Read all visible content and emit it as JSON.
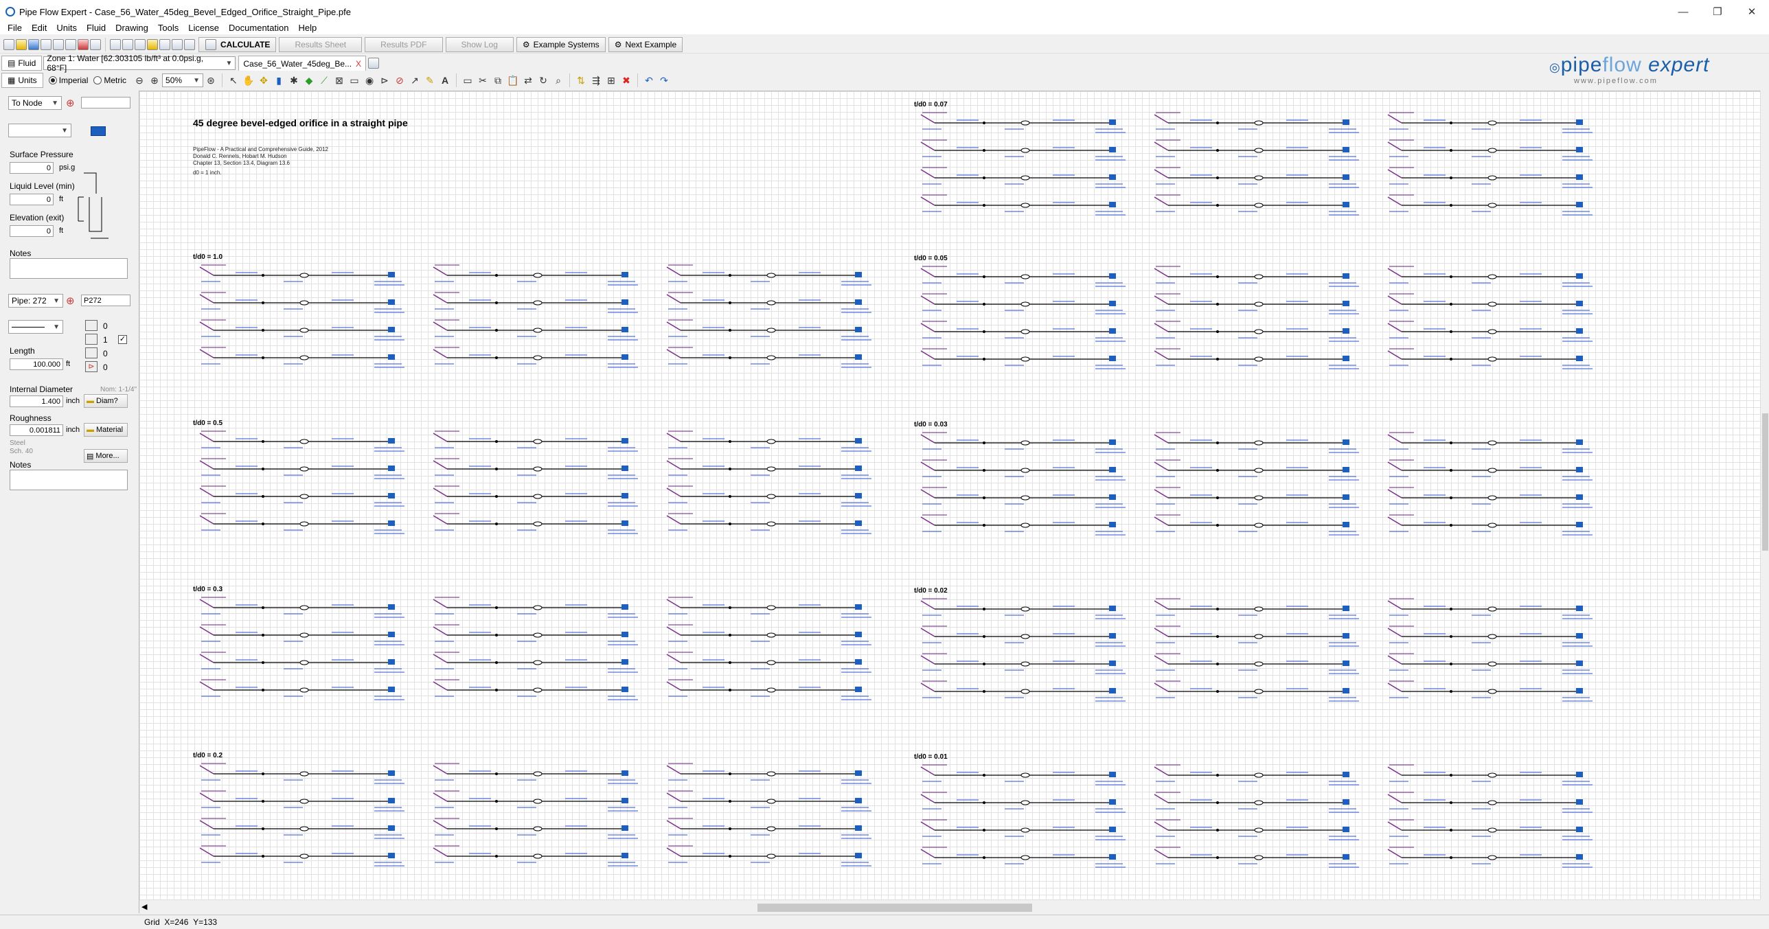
{
  "window": {
    "title": "Pipe Flow Expert - Case_56_Water_45deg_Bevel_Edged_Orifice_Straight_Pipe.pfe",
    "min": "—",
    "max": "❐",
    "close": "✕"
  },
  "menu": [
    "File",
    "Edit",
    "Units",
    "Fluid",
    "Drawing",
    "Tools",
    "License",
    "Documentation",
    "Help"
  ],
  "toolbar": {
    "calculate": "CALCULATE",
    "results_sheet": "Results Sheet",
    "results_pdf": "Results PDF",
    "show_log": "Show Log",
    "example_systems": "Example Systems",
    "next_example": "Next Example"
  },
  "fluid_bar": {
    "fluid_tab": "Fluid",
    "zone_value": "Zone 1: Water [62.303105 lb/ft³ at 0.0psi.g, 68°F]",
    "document_tab": "Case_56_Water_45deg_Be...",
    "document_close": "X"
  },
  "units_bar": {
    "units_tab": "Units",
    "imperial": "Imperial",
    "metric": "Metric",
    "zoom": "50%"
  },
  "logo": {
    "main": "pipe",
    "accent": "flow",
    "suffix": "expert",
    "url": "www.pipeflow.com"
  },
  "panel": {
    "node_select": "To Node",
    "surface_pressure_label": "Surface Pressure",
    "surface_pressure_value": "0",
    "surface_pressure_unit": "psi.g",
    "liquid_level_label": "Liquid Level (min)",
    "liquid_level_value": "0",
    "liquid_level_unit": "ft",
    "elevation_label": "Elevation (exit)",
    "elevation_value": "0",
    "elevation_unit": "ft",
    "notes_label": "Notes",
    "pipe_select": "Pipe: 272",
    "pipe_name": "P272",
    "counts": [
      "0",
      "1",
      "0",
      "0"
    ],
    "length_label": "Length",
    "length_value": "100.000",
    "length_unit": "ft",
    "diameter_label": "Internal Diameter",
    "diameter_value": "1.400",
    "diameter_unit": "inch",
    "diameter_btn": "Diam?",
    "nominal": "Nom: 1-1/4\"",
    "roughness_label": "Roughness",
    "roughness_value": "0.001811",
    "roughness_unit": "inch",
    "material_btn": "Material",
    "material_name": "Steel",
    "schedule": "Sch. 40",
    "more_btn": "More...",
    "notes2_label": "Notes"
  },
  "canvas": {
    "title": "45 degree bevel-edged orifice in a straight pipe",
    "source": [
      "PipeFlow - A Practical and Comprehensive Guide, 2012",
      "Donald C. Rennels, Hobart M. Hudson",
      "Chapter 13, Section 13.4, Diagram 13.6"
    ],
    "note": "d0 = 1 inch.",
    "sections_left": [
      "t/d0 = 1.0",
      "t/d0 = 0.5",
      "t/d0 = 0.3",
      "t/d0 = 0.2"
    ],
    "sections_right": [
      "t/d0 = 0.07",
      "t/d0 = 0.05",
      "t/d0 = 0.03",
      "t/d0 = 0.02",
      "t/d0 = 0.01"
    ]
  },
  "status": {
    "grid": "Grid",
    "x": "X=246",
    "y": "Y=133"
  }
}
